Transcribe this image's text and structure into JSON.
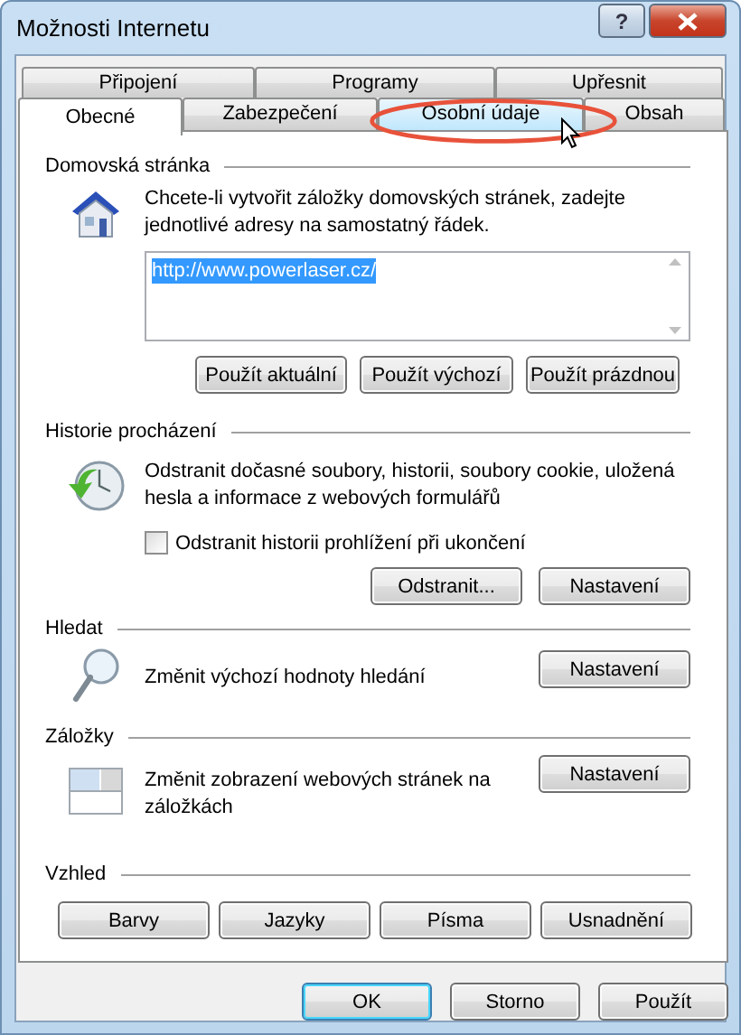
{
  "window": {
    "title": "Možnosti Internetu",
    "help": "?"
  },
  "tabs": {
    "back_row": [
      {
        "label": "Připojení",
        "selected": false,
        "hovered": false
      },
      {
        "label": "Programy",
        "selected": false,
        "hovered": false
      },
      {
        "label": "Upřesnit",
        "selected": false,
        "hovered": false
      }
    ],
    "front_row": [
      {
        "label": "Obecné",
        "selected": true,
        "hovered": false
      },
      {
        "label": "Zabezpečení",
        "selected": false,
        "hovered": false
      },
      {
        "label": "Osobní údaje",
        "selected": false,
        "hovered": true,
        "highlighted": true
      },
      {
        "label": "Obsah",
        "selected": false,
        "hovered": false
      }
    ]
  },
  "homepage": {
    "title": "Domovská stránka",
    "description": "Chcete-li vytvořit záložky domovských stránek, zadejte jednotlivé adresy na samostatný řádek.",
    "url": "http://www.powerlaser.cz/",
    "buttons": [
      "Použít aktuální",
      "Použít výchozí",
      "Použít prázdnou"
    ]
  },
  "history": {
    "title": "Historie procházení",
    "description": "Odstranit dočasné soubory, historii, soubory cookie, uložená hesla a informace z webových formulářů",
    "checkbox": {
      "label": "Odstranit historii prohlížení při ukončení",
      "checked": false
    },
    "buttons": [
      "Odstranit...",
      "Nastavení"
    ]
  },
  "search": {
    "title": "Hledat",
    "description": "Změnit výchozí hodnoty hledání",
    "button": "Nastavení"
  },
  "tabs_section": {
    "title": "Záložky",
    "description": "Změnit zobrazení webových stránek na záložkách",
    "button": "Nastavení"
  },
  "appearance": {
    "title": "Vzhled",
    "buttons": [
      "Barvy",
      "Jazyky",
      "Písma",
      "Usnadnění"
    ]
  },
  "footer": [
    {
      "label": "OK",
      "default": true
    },
    {
      "label": "Storno",
      "default": false
    },
    {
      "label": "Použít",
      "default": false
    }
  ]
}
